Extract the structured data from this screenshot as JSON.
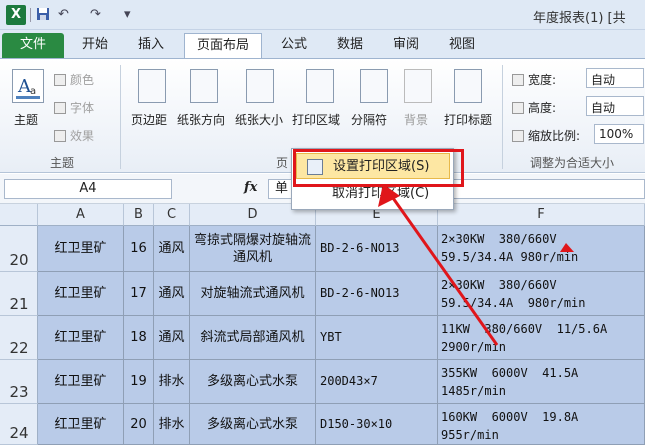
{
  "titlebar": {
    "app_logo": "X",
    "undo_glyph": "↶",
    "redo_glyph": "↷",
    "customize_glyph": "▾",
    "title": "年度报表(1) [共"
  },
  "tabs": [
    {
      "label": "文件"
    },
    {
      "label": "开始"
    },
    {
      "label": "插入"
    },
    {
      "label": "页面布局"
    },
    {
      "label": "公式"
    },
    {
      "label": "数据"
    },
    {
      "label": "审阅"
    },
    {
      "label": "视图"
    }
  ],
  "ribbon": {
    "theme": {
      "themes_label": "主题",
      "colors_label": "颜色",
      "fonts_label": "字体",
      "effects_label": "效果",
      "group_label": "主题"
    },
    "page_setup": {
      "margins": "页边距",
      "orientation": "纸张方向",
      "size": "纸张大小",
      "print_area": "打印区域",
      "breaks": "分隔符",
      "background": "背景",
      "print_titles": "打印标题",
      "group_label": "页"
    },
    "scale_to_fit": {
      "width_label": "宽度:",
      "width_value": "自动",
      "height_label": "高度:",
      "height_value": "自动",
      "scale_label": "缩放比例:",
      "scale_value": "100%",
      "group_label": "调整为合适大小"
    }
  },
  "formula_bar": {
    "name_box": "A4",
    "fx": "fx",
    "formula": "单"
  },
  "dropdown": {
    "set_print_area": "设置打印区域(S)",
    "clear_print_area": "取消打印区域(C)"
  },
  "columns": [
    "A",
    "B",
    "C",
    "D",
    "E",
    "F"
  ],
  "rows": [
    {
      "num": "20",
      "a": "红卫里矿",
      "b": "16",
      "c": "通风",
      "d": "弯掠式隔爆对旋轴流通风机",
      "e": "BD-2-6-NO13",
      "f": "2×30KW  380/660V\n59.5/34.4A 980r/min"
    },
    {
      "num": "21",
      "a": "红卫里矿",
      "b": "17",
      "c": "通风",
      "d": "对旋轴流式通风机",
      "e": "BD-2-6-NO13",
      "f": "2×30KW  380/660V\n59.5/34.4A  980r/min"
    },
    {
      "num": "22",
      "a": "红卫里矿",
      "b": "18",
      "c": "通风",
      "d": "斜流式局部通风机",
      "e": "YBT",
      "f": "11KW  380/660V  11/5.6A\n2900r/min"
    },
    {
      "num": "23",
      "a": "红卫里矿",
      "b": "19",
      "c": "排水",
      "d": "多级离心式水泵",
      "e": "200D43×7",
      "f": "355KW  6000V  41.5A\n1485r/min"
    },
    {
      "num": "24",
      "a": "红卫里矿",
      "b": "20",
      "c": "排水",
      "d": "多级离心式水泵",
      "e": "D150-30×10",
      "f": "160KW  6000V  19.8A\n955r/min"
    }
  ],
  "colors": {
    "selection": "#b9cbe8",
    "highlight": "#e0161b",
    "file_tab": "#2a8a42"
  }
}
